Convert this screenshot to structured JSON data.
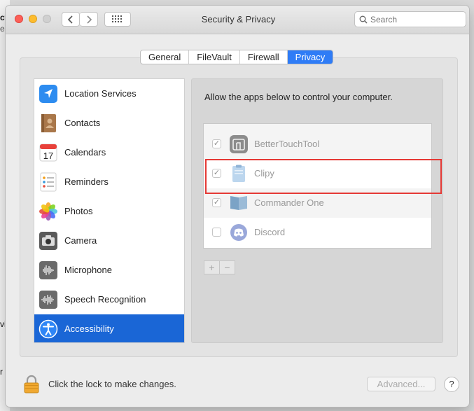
{
  "background": {
    "fragment_top": "ct",
    "fragment_top2": "e",
    "fragment_mid": "vi",
    "fragment_low": "r"
  },
  "window": {
    "title": "Security & Privacy",
    "search_placeholder": "Search"
  },
  "tabs": [
    "General",
    "FileVault",
    "Firewall",
    "Privacy"
  ],
  "active_tab": "Privacy",
  "categories": [
    {
      "label": "Location Services",
      "icon": "location-arrow-icon"
    },
    {
      "label": "Contacts",
      "icon": "contacts-book-icon"
    },
    {
      "label": "Calendars",
      "icon": "calendar-icon",
      "badge": "17"
    },
    {
      "label": "Reminders",
      "icon": "reminders-list-icon"
    },
    {
      "label": "Photos",
      "icon": "photos-flower-icon"
    },
    {
      "label": "Camera",
      "icon": "camera-icon"
    },
    {
      "label": "Microphone",
      "icon": "microphone-waveform-icon"
    },
    {
      "label": "Speech Recognition",
      "icon": "speech-waveform-icon"
    },
    {
      "label": "Accessibility",
      "icon": "accessibility-person-icon"
    }
  ],
  "active_category": "Accessibility",
  "right_panel": {
    "description": "Allow the apps below to control your computer.",
    "apps": [
      {
        "name": "BetterTouchTool",
        "checked": true,
        "icon": "bettertouchtool-icon"
      },
      {
        "name": "Clipy",
        "checked": true,
        "icon": "clipy-icon"
      },
      {
        "name": "Commander One",
        "checked": true,
        "icon": "commander-one-icon"
      },
      {
        "name": "Discord",
        "checked": false,
        "icon": "discord-icon"
      }
    ],
    "add_label": "+",
    "remove_label": "−"
  },
  "footer": {
    "lock_text": "Click the lock to make changes.",
    "advanced_label": "Advanced...",
    "help_label": "?"
  },
  "colors": {
    "accent": "#2f7cf6",
    "selected_row": "#1a66d6",
    "highlight_box": "#e53935"
  }
}
